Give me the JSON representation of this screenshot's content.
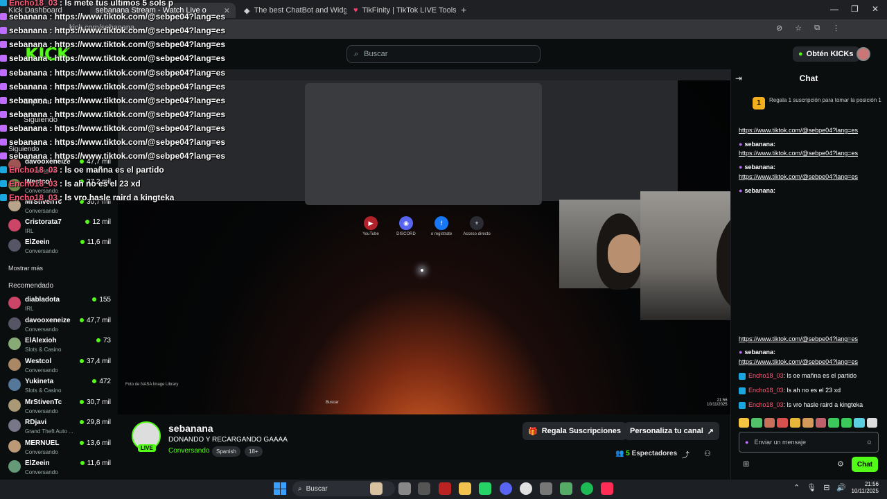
{
  "browser": {
    "tabs": [
      {
        "label": "Kick Dashboard"
      },
      {
        "label": "sebanana Stream - Watch Live o"
      },
      {
        "label": "The best ChatBot and Widg"
      },
      {
        "label": "TikFinity | TikTok LIVE Tools"
      }
    ],
    "url": "kick.com/sebanana"
  },
  "header": {
    "logo": "KICK",
    "search_placeholder": "Buscar",
    "kicks_button": "Obtén KICKs"
  },
  "sidebar": {
    "nav": [
      "Explorar",
      "Siguiendo"
    ],
    "following_title": "Siguiendo",
    "following": [
      {
        "name": "davooxeneize",
        "category": "Conversando",
        "viewers": "47,7 mil"
      },
      {
        "name": "Westcol",
        "category": "Conversando",
        "viewers": "37,2 mil"
      },
      {
        "name": "MrStivenTc",
        "category": "Conversando",
        "viewers": "30,7 mil"
      },
      {
        "name": "Cristorata7",
        "category": "IRL",
        "viewers": "12 mil"
      },
      {
        "name": "ElZeein",
        "category": "Conversando",
        "viewers": "11,6 mil"
      }
    ],
    "show_more": "Mostrar más",
    "recommended_title": "Recomendado",
    "recommended": [
      {
        "name": "diabladota",
        "category": "IRL",
        "viewers": "155"
      },
      {
        "name": "davooxeneize",
        "category": "Conversando",
        "viewers": "47,7 mil"
      },
      {
        "name": "ElAlexioh",
        "category": "Slots & Casino",
        "viewers": "73"
      },
      {
        "name": "Westcol",
        "category": "Conversando",
        "viewers": "37,4 mil"
      },
      {
        "name": "Yukineta",
        "category": "Slots & Casino",
        "viewers": "472"
      },
      {
        "name": "MrStivenTc",
        "category": "Conversando",
        "viewers": "30,7 mil"
      },
      {
        "name": "RDjavi",
        "category": "Grand Theft Auto ...",
        "viewers": "29,8 mil"
      },
      {
        "name": "MERNUEL",
        "category": "Conversando",
        "viewers": "13,6 mil"
      },
      {
        "name": "ElZeein",
        "category": "Conversando",
        "viewers": "11,6 mil"
      }
    ]
  },
  "overlay_chat": [
    {
      "user": "Encho18_03",
      "text": ": ls mete tus ultimos 5 sols p"
    },
    {
      "user": "sebanana",
      "text": ": https://www.tiktok.com/@sebpe04?lang=es"
    },
    {
      "user": "sebanana",
      "text": ": https://www.tiktok.com/@sebpe04?lang=es"
    },
    {
      "user": "sebanana",
      "text": ": https://www.tiktok.com/@sebpe04?lang=es"
    },
    {
      "user": "sebanana",
      "text": ": https://www.tiktok.com/@sebpe04?lang=es"
    },
    {
      "user": "sebanana",
      "text": ": https://www.tiktok.com/@sebpe04?lang=es"
    },
    {
      "user": "sebanana",
      "text": ": https://www.tiktok.com/@sebpe04?lang=es"
    },
    {
      "user": "sebanana",
      "text": ": https://www.tiktok.com/@sebpe04?lang=es"
    },
    {
      "user": "sebanana",
      "text": ": https://www.tiktok.com/@sebpe04?lang=es"
    },
    {
      "user": "sebanana",
      "text": ": https://www.tiktok.com/@sebpe04?lang=es"
    },
    {
      "user": "sebanana",
      "text": ": https://www.tiktok.com/@sebpe04?lang=es"
    },
    {
      "user": "sebanana",
      "text": ": https://www.tiktok.com/@sebpe04?lang=es"
    },
    {
      "user": "Encho18_03",
      "text": ": ls oe mañna es el partido"
    },
    {
      "user": "Encho18_03",
      "text": ": ls ah no es el 23 xd"
    },
    {
      "user": "Encho18_03",
      "text": ": ls vro hasle raird a kingteka"
    }
  ],
  "video": {
    "quick_links": [
      "YouTube",
      "DISCORD",
      "o regístrate",
      "Acceso directo"
    ],
    "photo_credit": "Foto de NASA Image Library",
    "inner_search": "Buscar",
    "inner_clock": "21:56\n10/11/2025"
  },
  "stream": {
    "channel": "sebanana",
    "live_badge": "LIVE",
    "title": "DONANDO Y RECARGANDO GAAAA",
    "category": "Conversando",
    "tags": [
      "Spanish",
      "18+"
    ],
    "gift_button": "Regala Suscripciones",
    "customize_button": "Personaliza tu canal",
    "viewers_count": "5",
    "viewers_label": "Espectadores"
  },
  "chat": {
    "title": "Chat",
    "gift_prompt": "Regala 1 suscripción para tomar la posición 1",
    "messages": [
      {
        "user": "",
        "text": "https://www.tiktok.com/@sebpe04?lang=es"
      },
      {
        "user": "sebanana:",
        "text": ""
      },
      {
        "user": "",
        "text": "https://www.tiktok.com/@sebpe04?lang=es"
      },
      {
        "user": "sebanana:",
        "text": ""
      },
      {
        "user": "",
        "text": "https://www.tiktok.com/@sebpe04?lang=es"
      },
      {
        "user": "sebanana:",
        "text": ""
      },
      {
        "user": "",
        "text": "https://www.tiktok.com/@sebpe04?lang=es"
      },
      {
        "user": "sebanana:",
        "text": ""
      },
      {
        "user": "",
        "text": "https://www.tiktok.com/@sebpe04?lang=es"
      }
    ],
    "encho_messages": [
      {
        "user": "Encho18_03",
        "text": ": ls oe mañna es el partido"
      },
      {
        "user": "Encho18_03",
        "text": ": ls ah no es el 23 xd"
      },
      {
        "user": "Encho18_03",
        "text": ": ls vro hasle raird a kingteka"
      }
    ],
    "input_placeholder": "Enviar un mensaje",
    "send_button": "Chat"
  },
  "taskbar": {
    "search": "Buscar",
    "time": "21:56",
    "date": "10/11/2025"
  },
  "colors": {
    "accent": "#53fc18",
    "bg": "#0b0e0f"
  }
}
